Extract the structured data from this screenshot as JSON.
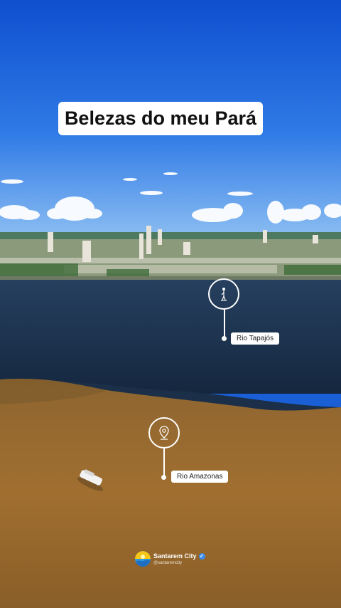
{
  "title": "Belezas do meu Pará",
  "markers": [
    {
      "label": "Rio Tapajós",
      "icon": "wakeboarder-icon"
    },
    {
      "label": "Rio Amazonas",
      "icon": "location-pin-icon"
    }
  ],
  "watermark": {
    "name": "Santarem City",
    "handle": "@santaremcity",
    "verified_icon": "verified-check-icon"
  },
  "colors": {
    "sky": "#1a5fd6",
    "tapajos_water": "#1c3350",
    "amazonas_water": "#9a6a2c"
  }
}
